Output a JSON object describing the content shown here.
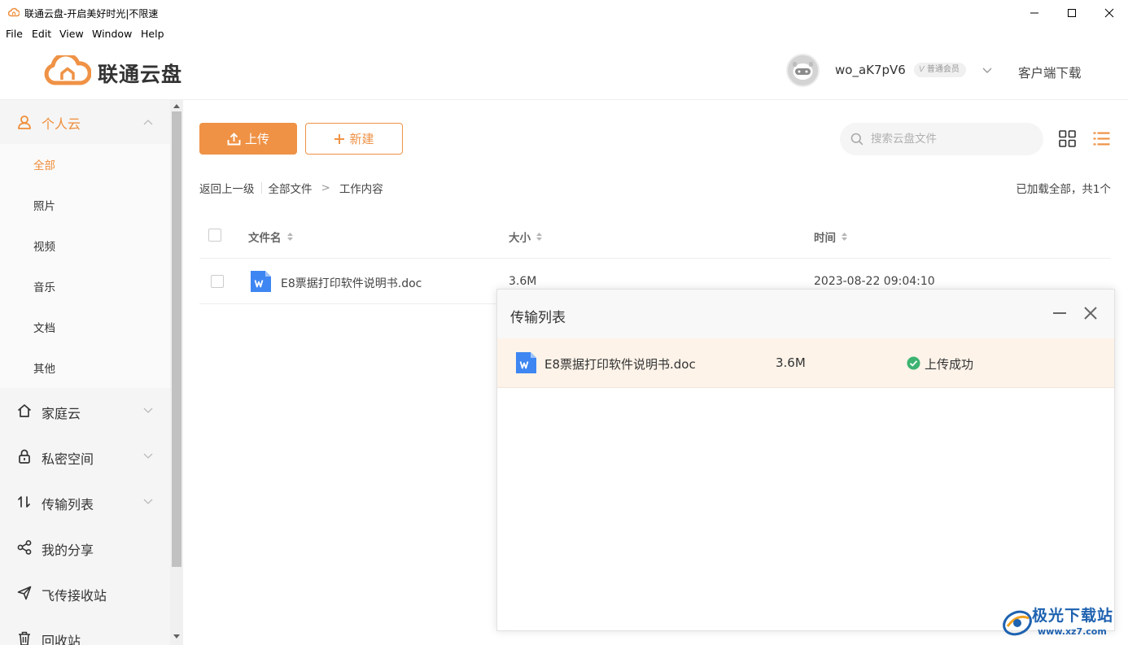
{
  "window": {
    "title": "联通云盘-开启美好时光|不限速"
  },
  "menu": [
    "File",
    "Edit",
    "View",
    "Window",
    "Help"
  ],
  "header": {
    "logo_text": "联通云盘",
    "username": "wo_aK7pV6",
    "member_badge_v": "V",
    "member_badge": "普通会员",
    "client_download": "客户端下载"
  },
  "sidebar": {
    "personal_cloud": "个人云",
    "sub_items": [
      {
        "label": "全部",
        "active": true
      },
      {
        "label": "照片",
        "active": false
      },
      {
        "label": "视频",
        "active": false
      },
      {
        "label": "音乐",
        "active": false
      },
      {
        "label": "文档",
        "active": false
      },
      {
        "label": "其他",
        "active": false
      }
    ],
    "items": [
      {
        "label": "家庭云",
        "icon": "home-icon",
        "expandable": true
      },
      {
        "label": "私密空间",
        "icon": "lock-icon",
        "expandable": true
      },
      {
        "label": "传输列表",
        "icon": "transfer-icon",
        "expandable": true
      },
      {
        "label": "我的分享",
        "icon": "share-icon",
        "expandable": false
      },
      {
        "label": "飞传接收站",
        "icon": "send-icon",
        "expandable": false
      },
      {
        "label": "回收站",
        "icon": "trash-icon",
        "expandable": false
      }
    ]
  },
  "toolbar": {
    "upload_label": "上传",
    "new_label": "新建",
    "search_placeholder": "搜索云盘文件"
  },
  "breadcrumb": {
    "back": "返回上一级",
    "root": "全部文件",
    "separator": ">",
    "current": "工作内容"
  },
  "loaded_info": "已加载全部，共1个",
  "table": {
    "columns": [
      "文件名",
      "大小",
      "时间"
    ],
    "rows": [
      {
        "name": "E8票据打印软件说明书.doc",
        "size": "3.6M",
        "time": "2023-08-22 09:04:10",
        "icon": "word-doc-icon"
      }
    ]
  },
  "transfer_panel": {
    "title": "传输列表",
    "items": [
      {
        "name": "E8票据打印软件说明书.doc",
        "size": "3.6M",
        "status": "上传成功",
        "icon": "word-doc-icon"
      }
    ]
  },
  "watermark": {
    "text": "极光下载站",
    "url": "www.xz7.com"
  },
  "colors": {
    "accent": "#ef9245",
    "active_text": "#ef8d3a",
    "success": "#3cb371",
    "sidebar_bg": "#f5f5f5",
    "transfer_row_bg": "#fdf3e9"
  }
}
